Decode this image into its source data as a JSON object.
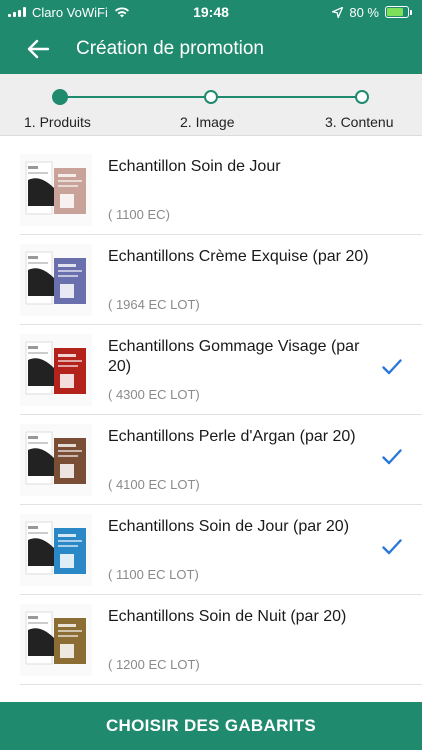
{
  "status_bar": {
    "carrier": "Claro VoWiFi",
    "time": "19:48",
    "battery_text": "80 %",
    "battery_level": 0.8
  },
  "app_bar": {
    "title": "Création de promotion",
    "back_icon": "arrow-left-icon"
  },
  "stepper": {
    "steps": [
      {
        "label": "1. Produits",
        "active": true
      },
      {
        "label": "2. Image",
        "active": false
      },
      {
        "label": "3. Contenu",
        "active": false
      }
    ]
  },
  "products": [
    {
      "name": "Echantillon Soin de Jour",
      "price": "( 1100 EC)",
      "selected": false,
      "thumb_color": "#c9a39a"
    },
    {
      "name": "Echantillons Crème Exquise (par 20)",
      "price": "( 1964 EC LOT)",
      "selected": false,
      "thumb_color": "#6a6fae"
    },
    {
      "name": "Echantillons Gommage Visage (par 20)",
      "price": "( 4300 EC LOT)",
      "selected": true,
      "thumb_color": "#b3221b"
    },
    {
      "name": "Echantillons Perle d'Argan (par 20)",
      "price": "( 4100 EC LOT)",
      "selected": true,
      "thumb_color": "#7a4e35"
    },
    {
      "name": "Echantillons Soin de Jour (par 20)",
      "price": "( 1100 EC LOT)",
      "selected": true,
      "thumb_color": "#2b88c6"
    },
    {
      "name": "Echantillons Soin de Nuit (par 20)",
      "price": "( 1200 EC LOT)",
      "selected": false,
      "thumb_color": "#8c6d34"
    }
  ],
  "footer": {
    "button_label": "CHOISIR DES GABARITS"
  },
  "colors": {
    "primary": "#1f8a6e",
    "check": "#2b78d6"
  }
}
